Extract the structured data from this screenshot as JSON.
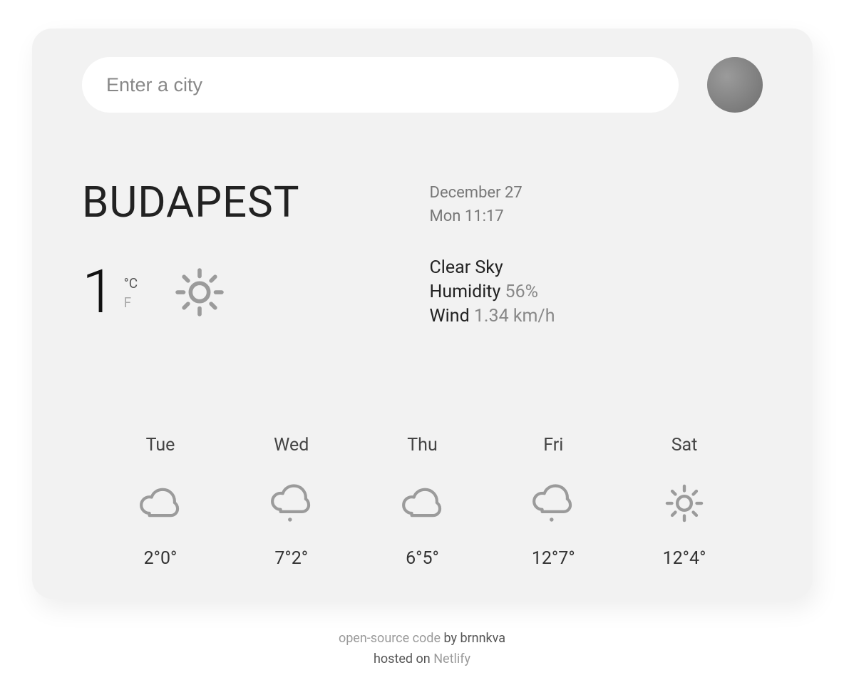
{
  "search": {
    "placeholder": "Enter a city"
  },
  "city": "BUDAPEST",
  "date": {
    "line1": "December 27",
    "line2": "Mon 11:17"
  },
  "current": {
    "temp": "1",
    "unit_c": "°C",
    "unit_f": "F",
    "icon": "clear-day",
    "condition": "Clear Sky",
    "humidity_label": "Humidity",
    "humidity_value": "56%",
    "wind_label": "Wind",
    "wind_value": "1.34 km/h"
  },
  "forecast": [
    {
      "day": "Tue",
      "icon": "cloudy",
      "hi": "2°",
      "lo": "0°"
    },
    {
      "day": "Wed",
      "icon": "drizzle",
      "hi": "7°",
      "lo": "2°"
    },
    {
      "day": "Thu",
      "icon": "cloudy",
      "hi": "6°",
      "lo": "5°"
    },
    {
      "day": "Fri",
      "icon": "drizzle",
      "hi": "12°",
      "lo": "7°"
    },
    {
      "day": "Sat",
      "icon": "clear-day",
      "hi": "12°",
      "lo": "4°"
    }
  ],
  "footer": {
    "osc": "open-source code",
    "by": " by brnnkva",
    "hosted": "hosted on ",
    "netlify": "Netlify"
  }
}
